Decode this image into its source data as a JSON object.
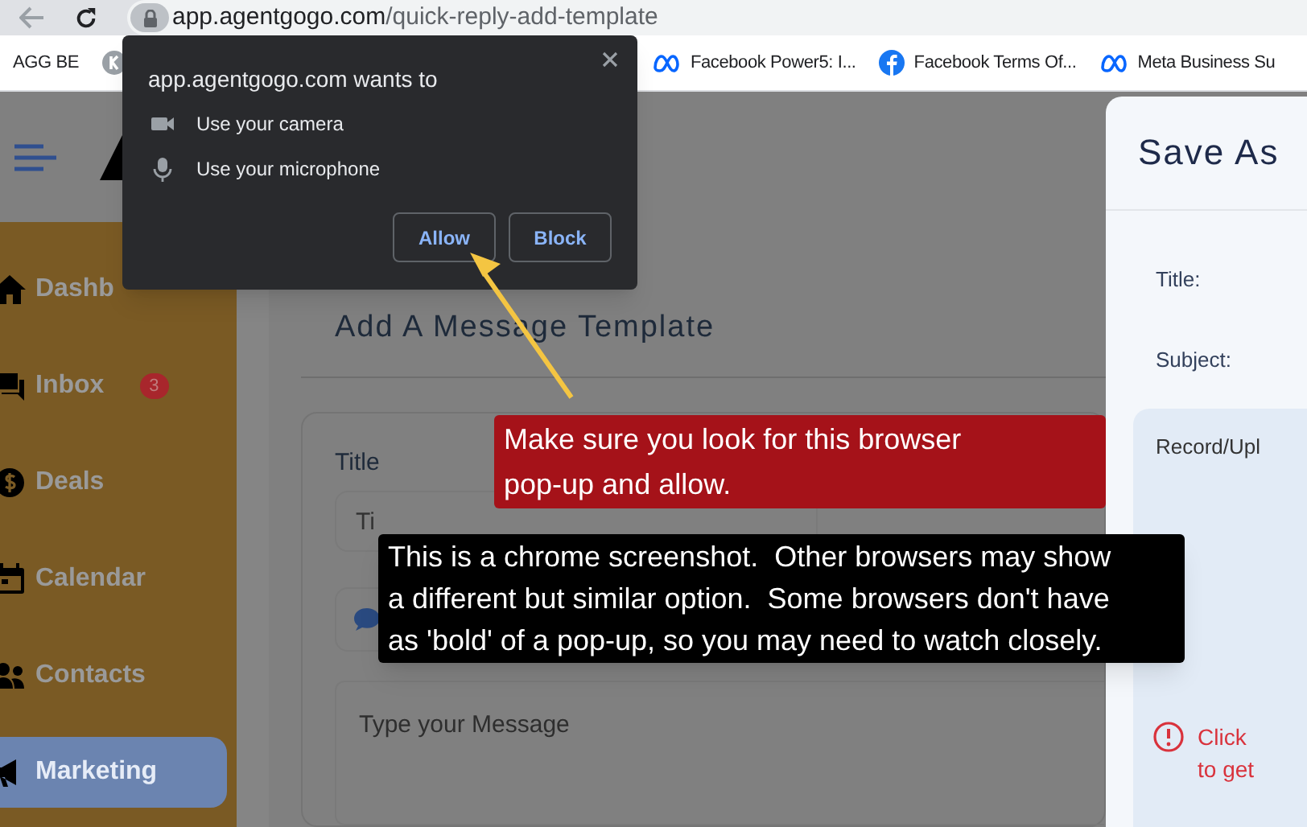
{
  "browser": {
    "url_host": "app.agentgogo.com",
    "url_path": "/quick-reply-add-template",
    "bookmarks": [
      {
        "kind": "plain",
        "label": "AGG BE"
      },
      {
        "kind": "k-logo"
      },
      {
        "kind": "meta",
        "label": "Facebook Power5: I..."
      },
      {
        "kind": "facebook",
        "label": "Facebook Terms Of..."
      },
      {
        "kind": "meta",
        "label": "Meta Business Su"
      }
    ]
  },
  "sidebar": {
    "items": [
      {
        "kind": "home",
        "label": "Dashb",
        "selected": false
      },
      {
        "kind": "inbox",
        "label": "Inbox",
        "badge": "3",
        "selected": false
      },
      {
        "kind": "deals",
        "label": "Deals",
        "selected": false
      },
      {
        "kind": "calendar",
        "label": "Calendar",
        "selected": false
      },
      {
        "kind": "contacts",
        "label": "Contacts",
        "selected": false
      },
      {
        "kind": "marketing",
        "label": "Marketing",
        "selected": true
      }
    ]
  },
  "main": {
    "heading": "Add A Message Template",
    "title_label": "Title",
    "title_placeholder": "Ti",
    "message_placeholder": "Type your Message"
  },
  "side_panel": {
    "title": "Save As",
    "fields": [
      "Title:",
      "Subject:"
    ],
    "record_label": "Record/Upl",
    "error_lines": [
      "Click",
      "to get"
    ]
  },
  "permission_popup": {
    "title": "app.agentgogo.com wants to",
    "permissions": [
      {
        "kind": "camera",
        "label": "Use your camera"
      },
      {
        "kind": "microphone",
        "label": "Use your microphone"
      }
    ],
    "buttons": [
      "Allow",
      "Block"
    ]
  },
  "annotations": {
    "red_note": "Make sure you look for this browser pop-up and allow.",
    "black_note": "This is a chrome screenshot.  Other browsers may show a different but similar option.  Some browsers don't have as 'bold' of a pop-up, so you may need to watch closely."
  }
}
